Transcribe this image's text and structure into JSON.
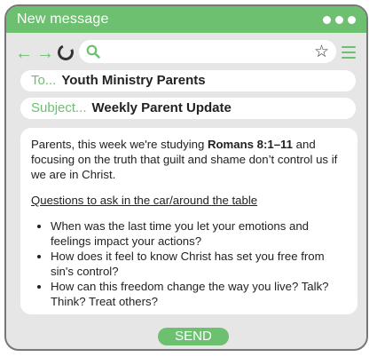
{
  "window": {
    "title": "New message"
  },
  "compose": {
    "to_label": "To...",
    "to_value": "Youth Ministry Parents",
    "subject_label": "Subject...",
    "subject_value": "Weekly Parent Update"
  },
  "message": {
    "intro_before": "Parents, this week we're studying ",
    "intro_bold": "Romans 8:1–11",
    "intro_after": " and focusing on the truth that guilt and shame don’t control us if we are in Christ.",
    "questions_heading": "Questions to ask in the car/around the table",
    "questions": [
      "When was the last time you let your emotions and feelings impact your actions?",
      "How does it feel to know Christ has set you free from sin's control?",
      "How can this freedom change the way you live? Talk? Think? Treat others?"
    ]
  },
  "actions": {
    "send_label": "SEND"
  },
  "icons": {
    "back": "arrow-left-icon",
    "forward": "arrow-right-icon",
    "refresh": "refresh-icon",
    "search": "search-icon",
    "favorite": "star-icon",
    "menu": "hamburger-menu-icon",
    "window_options": "dots-icon"
  },
  "colors": {
    "accent": "#6cc070",
    "window_bg": "#e6e6e6",
    "border": "#777777"
  }
}
